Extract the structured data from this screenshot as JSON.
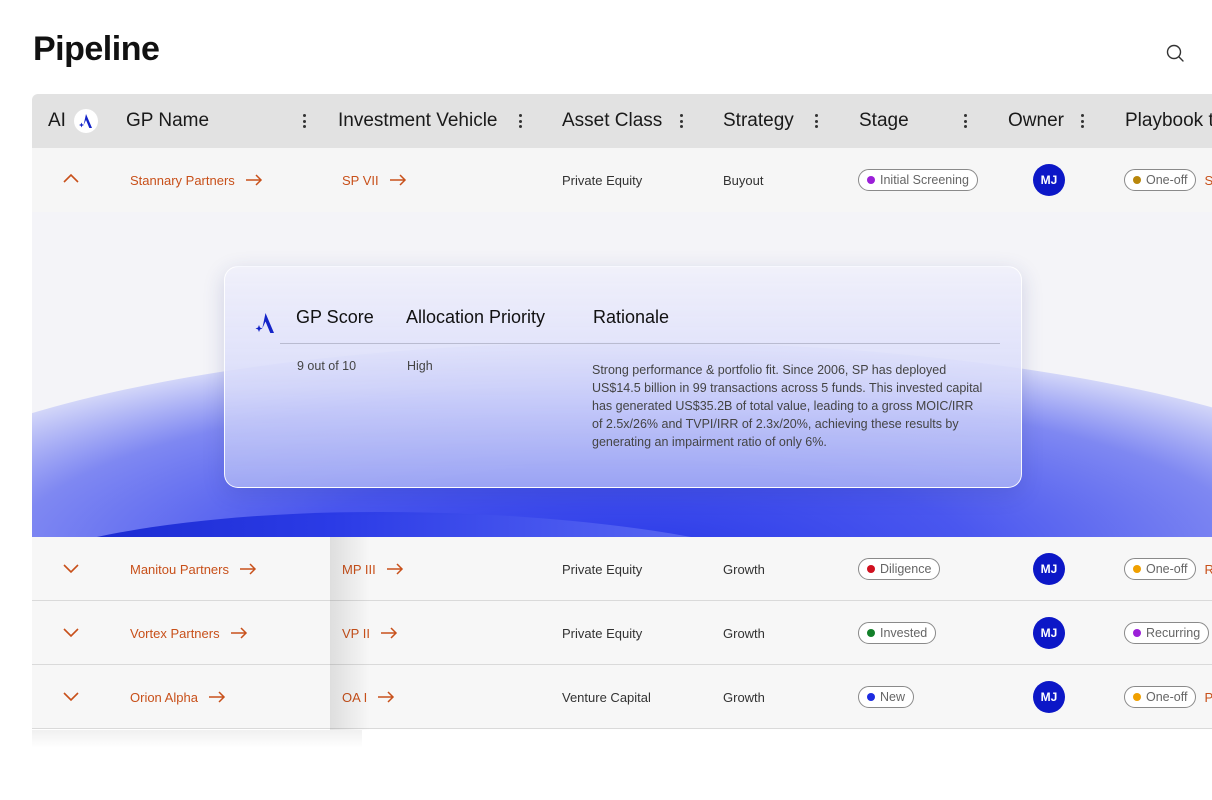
{
  "page": {
    "title": "Pipeline"
  },
  "header": {
    "ai": "AI",
    "columns": [
      "GP Name",
      "Investment Vehicle",
      "Asset Class",
      "Strategy",
      "Stage",
      "Owner",
      "Playbook t"
    ]
  },
  "rows": [
    {
      "gp": "Stannary Partners",
      "vehicle": "SP VII",
      "asset": "Private Equity",
      "strategy": "Buyout",
      "stage": "Initial Screening",
      "stage_color": "#9b1fd8",
      "owner": "MJ",
      "playbook": "One-off",
      "playbook_color": "#b8860b",
      "trail": "S",
      "expanded": true
    },
    {
      "gp": "Manitou Partners",
      "vehicle": "MP III",
      "asset": "Private Equity",
      "strategy": "Growth",
      "stage": "Diligence",
      "stage_color": "#d0101f",
      "owner": "MJ",
      "playbook": "One-off",
      "playbook_color": "#f0a000",
      "trail": "R"
    },
    {
      "gp": "Vortex Partners",
      "vehicle": "VP II",
      "asset": "Private Equity",
      "strategy": "Growth",
      "stage": "Invested",
      "stage_color": "#13802a",
      "owner": "MJ",
      "playbook": "Recurring",
      "playbook_color": "#9b1fd8",
      "trail": ""
    },
    {
      "gp": "Orion Alpha",
      "vehicle": "OA I",
      "asset": "Venture Capital",
      "strategy": "Growth",
      "stage": "New",
      "stage_color": "#1d2ce0",
      "owner": "MJ",
      "playbook": "One-off",
      "playbook_color": "#f0a000",
      "trail": "P"
    }
  ],
  "insight": {
    "headers": {
      "score": "GP Score",
      "priority": "Allocation Priority",
      "rationale": "Rationale"
    },
    "score": "9 out of 10",
    "priority": "High",
    "rationale": "Strong performance & portfolio fit. Since 2006, SP has deployed US$14.5 billion in 99 transactions across 5 funds. This invested capital has generated US$35.2B of total value, leading to a gross MOIC/IRR of 2.5x/26% and TVPI/IRR of 2.3x/20%, achieving these results by generating an impairment ratio of only 6%."
  },
  "colors": {
    "accent_link": "#c8501a",
    "avatar": "#0c17c7",
    "brand": "#1424c8"
  },
  "icons": {
    "search": "search-icon",
    "ai_logo": "ai-logo-icon",
    "row_link": "arrow-right-icon",
    "expand": "chevron-icon",
    "menu": "kebab-menu-icon"
  }
}
